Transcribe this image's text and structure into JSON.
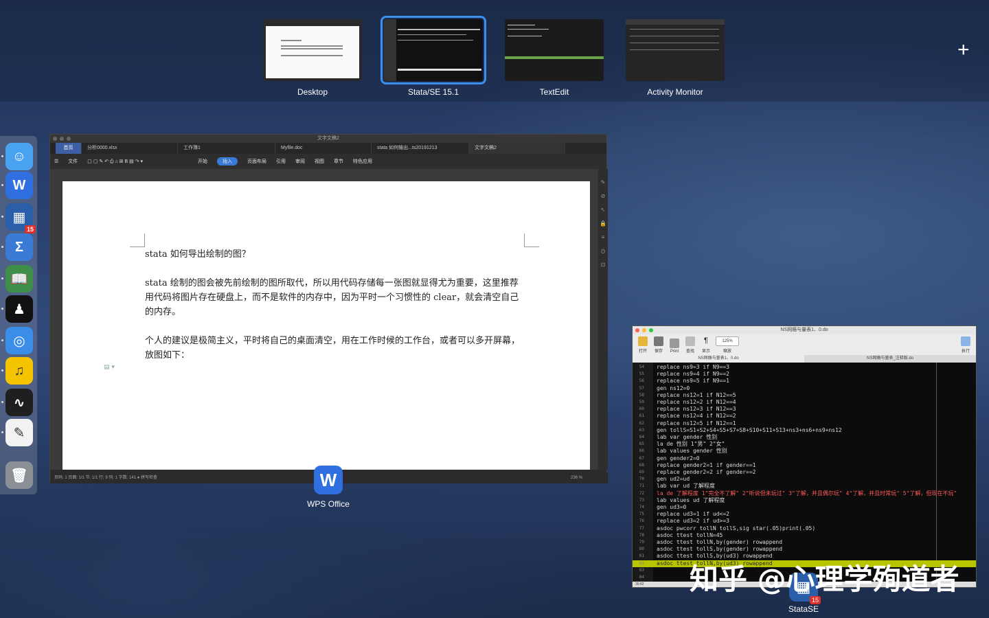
{
  "spaces": [
    {
      "label": "Desktop",
      "active": false
    },
    {
      "label": "Stata/SE 15.1",
      "active": true
    },
    {
      "label": "TextEdit",
      "active": false
    },
    {
      "label": "Activity Monitor",
      "active": false
    }
  ],
  "add_space_glyph": "+",
  "dock": {
    "items": [
      {
        "name": "finder-icon",
        "glyph": "☺",
        "bg": "#4aa3f0"
      },
      {
        "name": "wps-icon",
        "glyph": "W",
        "bg": "#2f6fe0"
      },
      {
        "name": "stata-icon",
        "glyph": "▦",
        "bg": "#2b5ea8",
        "badge": "15"
      },
      {
        "name": "sigma-icon",
        "glyph": "Σ",
        "bg": "#3a7bd5"
      },
      {
        "name": "book-icon",
        "glyph": "📖",
        "bg": "#3f8f4a"
      },
      {
        "name": "kindle-icon",
        "glyph": "♟",
        "bg": "#111111"
      },
      {
        "name": "safari-icon",
        "glyph": "◎",
        "bg": "#3a8ee8"
      },
      {
        "name": "music-icon",
        "glyph": "♫",
        "bg": "#f5c400"
      },
      {
        "name": "activity-monitor-icon",
        "glyph": "∿",
        "bg": "#1f1f1f"
      },
      {
        "name": "textedit-icon",
        "glyph": "✎",
        "bg": "#f2f2f2"
      },
      {
        "name": "trash-icon",
        "glyph": "🗑",
        "bg": "#8a8f96"
      }
    ]
  },
  "wps": {
    "window_title": "文字文稿2",
    "tabs": [
      "首页",
      "分析0000.xlsx",
      "工作簿1",
      "Myfile.doc",
      "stata 如何输出...ts20191213",
      "文字文稿2"
    ],
    "menu": [
      "文件",
      "开始",
      "插入",
      "页面布局",
      "引用",
      "审阅",
      "视图",
      "章节",
      "特色应用"
    ],
    "active_menu": "插入",
    "paragraphs": [
      "stata 如何导出绘制的图？",
      "stata 绘制的图会被先前绘制的图所取代，所以用代码存储每一张图就显得尤为重要，这里推荐用代码将图片存在硬盘上，而不是软件的内存中，因为平时一个习惯性的 clear，就会清空自己的内存。",
      "个人的建议是极简主义，平时将自己的桌面清空，用在工作时候的工作台，或者可以多开屏幕，放图如下："
    ],
    "status": "页码: 1    页面: 1/1    节: 1/1    行: 9    列: 1    字数: 141    ● 拼写检查",
    "zoom": "236 %",
    "caption": "WPS Office"
  },
  "stata": {
    "window_title": "NS网瘾与量表1、0.do",
    "toolbar": [
      "打开",
      "保存",
      "Print",
      "查找",
      "显示",
      "缩放",
      "执行"
    ],
    "zoom": "125%",
    "tabs": [
      "NS网瘾与量表1、0.do",
      "NS网瘾与量表_注释版.do"
    ],
    "lines": [
      {
        "n": "54",
        "t": "replace ns9=3 if N9==3"
      },
      {
        "n": "55",
        "t": "replace ns9=4 if N9==2"
      },
      {
        "n": "56",
        "t": "replace ns9=5 if N9==1"
      },
      {
        "n": "57",
        "t": "gen ns12=0"
      },
      {
        "n": "58",
        "t": "replace ns12=1 if N12==5"
      },
      {
        "n": "59",
        "t": "replace ns12=2 if N12==4"
      },
      {
        "n": "60",
        "t": "replace ns12=3 if N12==3"
      },
      {
        "n": "61",
        "t": "replace ns12=4 if N12==2"
      },
      {
        "n": "62",
        "t": "replace ns12=5 if N12==1"
      },
      {
        "n": "63",
        "t": "gen tollS=S1+S2+S4+S5+S7+S8+S10+S11+S13+ns3+ns6+ns9+ns12"
      },
      {
        "n": "64",
        "t": "lab var gender 性别"
      },
      {
        "n": "65",
        "t": "la de 性别 1\"男\" 2\"女\""
      },
      {
        "n": "66",
        "t": "lab values gender 性别"
      },
      {
        "n": "67",
        "t": "gen gender2=0"
      },
      {
        "n": "68",
        "t": "replace gender2=1 if gender==1"
      },
      {
        "n": "69",
        "t": "replace gender2=2 if gender==2"
      },
      {
        "n": "70",
        "t": "gen ud2=ud"
      },
      {
        "n": "71",
        "t": "lab var ud 了解程度"
      },
      {
        "n": "72",
        "t": "la de 了解程度 1\"完全不了解\" 2\"听说但未玩过\" 3\"了解，并且偶尔玩\" 4\"了解，并且时常玩\" 5\"了解，但现在不玩\""
      },
      {
        "n": "73",
        "t": "lab values ud 了解程度"
      },
      {
        "n": "74",
        "t": "gen ud3=0"
      },
      {
        "n": "75",
        "t": "replace ud3=1 if ud<=2"
      },
      {
        "n": "76",
        "t": "replace ud3=2 if ud>=3"
      },
      {
        "n": "77",
        "t": "asdoc pwcorr tollN tollS,sig star(.05)print(.05)"
      },
      {
        "n": "78",
        "t": "asdoc ttest tollN=45"
      },
      {
        "n": "79",
        "t": "asdoc ttest tollN,by(gender) rowappend"
      },
      {
        "n": "80",
        "t": "asdoc ttest tollS,by(gender) rowappend"
      },
      {
        "n": "81",
        "t": "asdoc ttest tollS,by(ud3) rowappend"
      },
      {
        "n": "82",
        "t": "asdoc ttest tollN,by(ud3) rowappend"
      },
      {
        "n": "83",
        "t": ""
      },
      {
        "n": "84",
        "t": ""
      }
    ],
    "status": "36:82",
    "caption": "StataSE",
    "badge": "15"
  },
  "watermark": "知乎 @心理学殉道者"
}
